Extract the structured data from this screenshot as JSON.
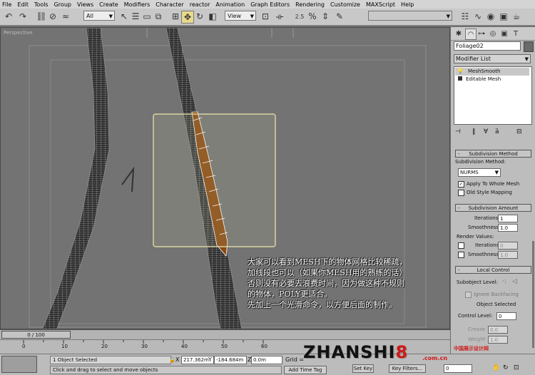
{
  "menu": [
    "File",
    "Edit",
    "Tools",
    "Group",
    "Views",
    "Create",
    "Modifiers",
    "Character",
    "reactor",
    "Animation",
    "Graph Editors",
    "Rendering",
    "Customize",
    "MAXScript",
    "Help"
  ],
  "toolbar": {
    "selection_filter": "All",
    "reference_coord": "View",
    "snap_angle_label": "2.5",
    "named_selection": ""
  },
  "viewport": {
    "label": "Perspective"
  },
  "caption": {
    "lines": [
      "大家可以看到MESH下的物体网格比较稀疏，",
      "加线段也可以（如果你MESH用的熟练的话）",
      "否则没有必要去浪费时间，因为做这种不规则",
      "的物体，POLY更适合。",
      "先加上一个光滑命令，以方便后面的制作。"
    ]
  },
  "command_panel": {
    "object_name": "Foliage02",
    "modifier_list": "Modifier List",
    "stack": [
      {
        "label": "MeshSmooth",
        "active": true
      },
      {
        "label": "Editable Mesh",
        "active": false
      }
    ],
    "subdivision_method": {
      "title": "Subdivision Method",
      "method_label": "Subdivision Method:",
      "method_value": "NURMS",
      "apply_whole_mesh": "Apply To Whole Mesh",
      "old_style_mapping": "Old Style Mapping"
    },
    "subdivision_amount": {
      "title": "Subdivision Amount",
      "iterations_label": "Iterations:",
      "iterations_value": "1",
      "smoothness_label": "Smoothness:",
      "smoothness_value": "1.0",
      "render_values": "Render Values:",
      "r_iterations_label": "Iterations:",
      "r_iterations_value": "0",
      "r_smoothness_label": "Smoothness:",
      "r_smoothness_value": "1.0"
    },
    "local_control": {
      "title": "Local Control",
      "subobject_label": "Subobject Level:",
      "ignore_backfacing": "Ignore Backfacing",
      "object_selected": "Object Selected",
      "control_level_label": "Control Level:",
      "control_level_value": "0",
      "crease_label": "Crease",
      "crease_value": "0.0",
      "weight_label": "Weight",
      "weight_value": "1.0"
    }
  },
  "timeline": {
    "slider": "0 / 100",
    "ticks": [
      "0",
      "10",
      "20",
      "30",
      "40",
      "50",
      "60"
    ]
  },
  "status": {
    "selected": "1 Object Selected",
    "prompt": "Click and drag to select and move objects",
    "x_label": "X",
    "x_value": "217.362m",
    "y_label": "Y",
    "y_value": "-184.684m",
    "z_label": "Z",
    "z_value": "0.0m",
    "grid": "Grid =",
    "add_time_tag": "Add Time Tag",
    "set_key": "Set Key",
    "key_filters": "Key Filters...",
    "frame": "0"
  },
  "watermark": {
    "text_a": "ZHANSHI",
    "text_b": "8",
    "url": ".com.cn",
    "small": "中国展示设计网"
  }
}
